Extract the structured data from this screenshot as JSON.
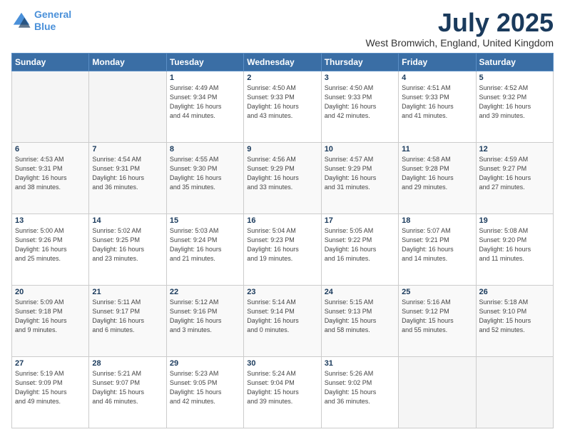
{
  "logo": {
    "line1": "General",
    "line2": "Blue"
  },
  "title": "July 2025",
  "subtitle": "West Bromwich, England, United Kingdom",
  "headers": [
    "Sunday",
    "Monday",
    "Tuesday",
    "Wednesday",
    "Thursday",
    "Friday",
    "Saturday"
  ],
  "weeks": [
    [
      {
        "num": "",
        "info": ""
      },
      {
        "num": "",
        "info": ""
      },
      {
        "num": "1",
        "info": "Sunrise: 4:49 AM\nSunset: 9:34 PM\nDaylight: 16 hours\nand 44 minutes."
      },
      {
        "num": "2",
        "info": "Sunrise: 4:50 AM\nSunset: 9:33 PM\nDaylight: 16 hours\nand 43 minutes."
      },
      {
        "num": "3",
        "info": "Sunrise: 4:50 AM\nSunset: 9:33 PM\nDaylight: 16 hours\nand 42 minutes."
      },
      {
        "num": "4",
        "info": "Sunrise: 4:51 AM\nSunset: 9:33 PM\nDaylight: 16 hours\nand 41 minutes."
      },
      {
        "num": "5",
        "info": "Sunrise: 4:52 AM\nSunset: 9:32 PM\nDaylight: 16 hours\nand 39 minutes."
      }
    ],
    [
      {
        "num": "6",
        "info": "Sunrise: 4:53 AM\nSunset: 9:31 PM\nDaylight: 16 hours\nand 38 minutes."
      },
      {
        "num": "7",
        "info": "Sunrise: 4:54 AM\nSunset: 9:31 PM\nDaylight: 16 hours\nand 36 minutes."
      },
      {
        "num": "8",
        "info": "Sunrise: 4:55 AM\nSunset: 9:30 PM\nDaylight: 16 hours\nand 35 minutes."
      },
      {
        "num": "9",
        "info": "Sunrise: 4:56 AM\nSunset: 9:29 PM\nDaylight: 16 hours\nand 33 minutes."
      },
      {
        "num": "10",
        "info": "Sunrise: 4:57 AM\nSunset: 9:29 PM\nDaylight: 16 hours\nand 31 minutes."
      },
      {
        "num": "11",
        "info": "Sunrise: 4:58 AM\nSunset: 9:28 PM\nDaylight: 16 hours\nand 29 minutes."
      },
      {
        "num": "12",
        "info": "Sunrise: 4:59 AM\nSunset: 9:27 PM\nDaylight: 16 hours\nand 27 minutes."
      }
    ],
    [
      {
        "num": "13",
        "info": "Sunrise: 5:00 AM\nSunset: 9:26 PM\nDaylight: 16 hours\nand 25 minutes."
      },
      {
        "num": "14",
        "info": "Sunrise: 5:02 AM\nSunset: 9:25 PM\nDaylight: 16 hours\nand 23 minutes."
      },
      {
        "num": "15",
        "info": "Sunrise: 5:03 AM\nSunset: 9:24 PM\nDaylight: 16 hours\nand 21 minutes."
      },
      {
        "num": "16",
        "info": "Sunrise: 5:04 AM\nSunset: 9:23 PM\nDaylight: 16 hours\nand 19 minutes."
      },
      {
        "num": "17",
        "info": "Sunrise: 5:05 AM\nSunset: 9:22 PM\nDaylight: 16 hours\nand 16 minutes."
      },
      {
        "num": "18",
        "info": "Sunrise: 5:07 AM\nSunset: 9:21 PM\nDaylight: 16 hours\nand 14 minutes."
      },
      {
        "num": "19",
        "info": "Sunrise: 5:08 AM\nSunset: 9:20 PM\nDaylight: 16 hours\nand 11 minutes."
      }
    ],
    [
      {
        "num": "20",
        "info": "Sunrise: 5:09 AM\nSunset: 9:18 PM\nDaylight: 16 hours\nand 9 minutes."
      },
      {
        "num": "21",
        "info": "Sunrise: 5:11 AM\nSunset: 9:17 PM\nDaylight: 16 hours\nand 6 minutes."
      },
      {
        "num": "22",
        "info": "Sunrise: 5:12 AM\nSunset: 9:16 PM\nDaylight: 16 hours\nand 3 minutes."
      },
      {
        "num": "23",
        "info": "Sunrise: 5:14 AM\nSunset: 9:14 PM\nDaylight: 16 hours\nand 0 minutes."
      },
      {
        "num": "24",
        "info": "Sunrise: 5:15 AM\nSunset: 9:13 PM\nDaylight: 15 hours\nand 58 minutes."
      },
      {
        "num": "25",
        "info": "Sunrise: 5:16 AM\nSunset: 9:12 PM\nDaylight: 15 hours\nand 55 minutes."
      },
      {
        "num": "26",
        "info": "Sunrise: 5:18 AM\nSunset: 9:10 PM\nDaylight: 15 hours\nand 52 minutes."
      }
    ],
    [
      {
        "num": "27",
        "info": "Sunrise: 5:19 AM\nSunset: 9:09 PM\nDaylight: 15 hours\nand 49 minutes."
      },
      {
        "num": "28",
        "info": "Sunrise: 5:21 AM\nSunset: 9:07 PM\nDaylight: 15 hours\nand 46 minutes."
      },
      {
        "num": "29",
        "info": "Sunrise: 5:23 AM\nSunset: 9:05 PM\nDaylight: 15 hours\nand 42 minutes."
      },
      {
        "num": "30",
        "info": "Sunrise: 5:24 AM\nSunset: 9:04 PM\nDaylight: 15 hours\nand 39 minutes."
      },
      {
        "num": "31",
        "info": "Sunrise: 5:26 AM\nSunset: 9:02 PM\nDaylight: 15 hours\nand 36 minutes."
      },
      {
        "num": "",
        "info": ""
      },
      {
        "num": "",
        "info": ""
      }
    ]
  ]
}
